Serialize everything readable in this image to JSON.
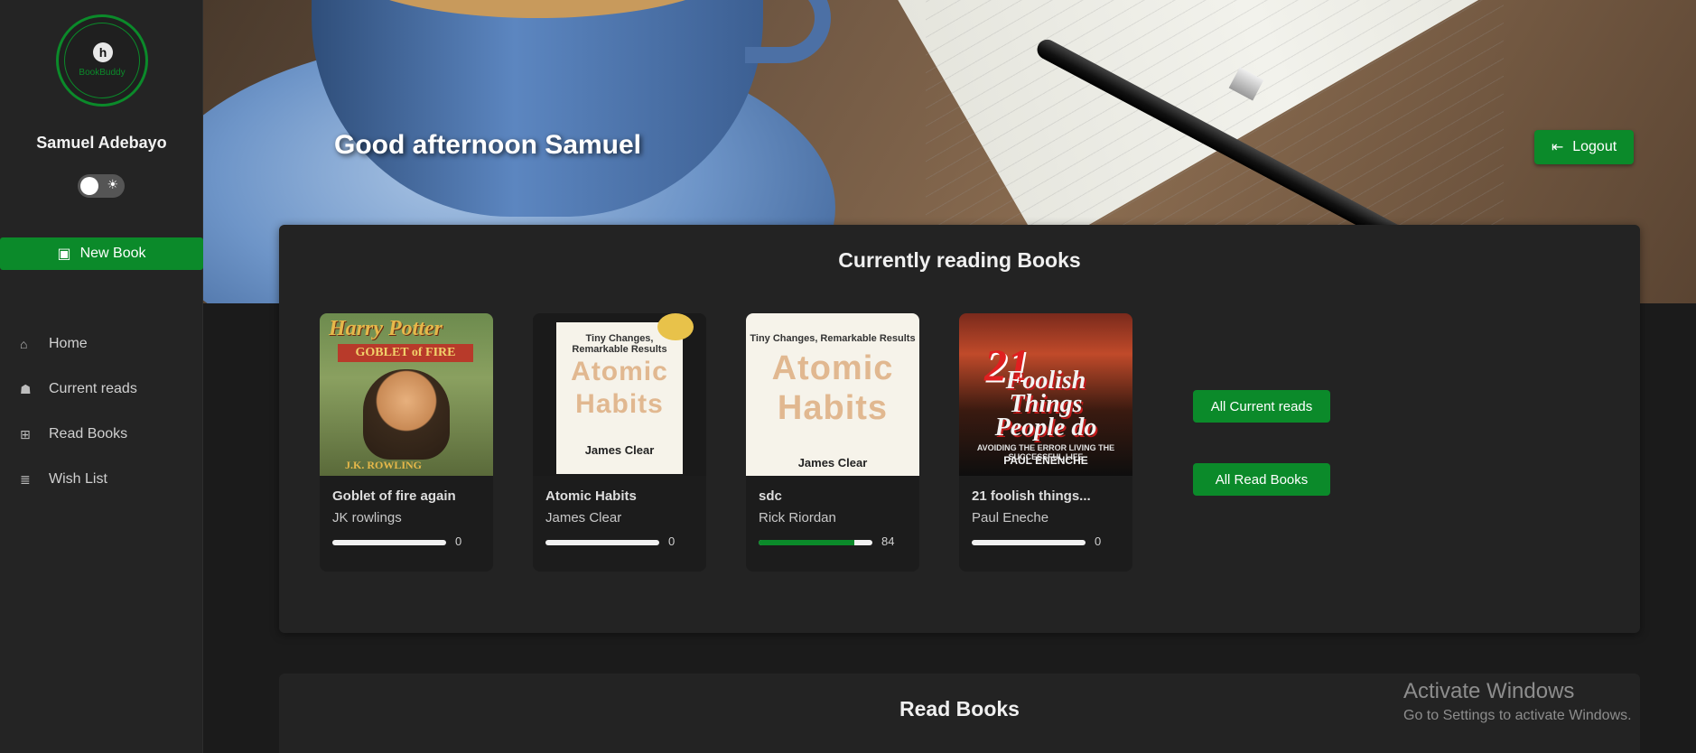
{
  "sidebar": {
    "logo_brand": "BookBuddy",
    "user_name": "Samuel Adebayo",
    "new_book_label": "New Book",
    "nav": [
      {
        "label": "Home",
        "icon": "home-icon"
      },
      {
        "label": "Current reads",
        "icon": "reading-icon"
      },
      {
        "label": "Read Books",
        "icon": "open-book-icon"
      },
      {
        "label": "Wish List",
        "icon": "books-stack-icon"
      }
    ]
  },
  "header": {
    "greeting": "Good afternoon Samuel",
    "logout_label": "Logout"
  },
  "current_reads": {
    "title": "Currently reading Books",
    "books": [
      {
        "title": "Goblet of fire again",
        "author": "JK rowlings",
        "progress": 0
      },
      {
        "title": "Atomic Habits",
        "author": "James Clear",
        "progress": 0
      },
      {
        "title": "sdc",
        "author": "Rick Riordan",
        "progress": 84
      },
      {
        "title": "21 foolish things...",
        "author": "Paul Eneche",
        "progress": 0
      }
    ],
    "all_current_label": "All Current reads",
    "all_read_label": "All Read Books"
  },
  "covers": {
    "hp": {
      "line1": "Harry Potter",
      "line2": "GOBLET of FIRE",
      "author": "J.K. ROWLING"
    },
    "ah": {
      "sub": "Tiny Changes, Remarkable Results",
      "word1": "Atomic",
      "word2": "Habits",
      "author": "James Clear"
    },
    "fool": {
      "num": "21",
      "w1": "Foolish",
      "w2": "Things",
      "w3": "People do",
      "tag": "AVOIDING THE ERROR LIVING THE SUCCESSFUL LIFE",
      "author": "PAUL ENENCHE"
    }
  },
  "read_books": {
    "title": "Read Books"
  },
  "watermark": {
    "line1": "Activate Windows",
    "line2": "Go to Settings to activate Windows."
  },
  "colors": {
    "accent": "#0b8a2a",
    "background": "#1b1b1b",
    "panel": "#232323",
    "sidebar": "#242424"
  }
}
